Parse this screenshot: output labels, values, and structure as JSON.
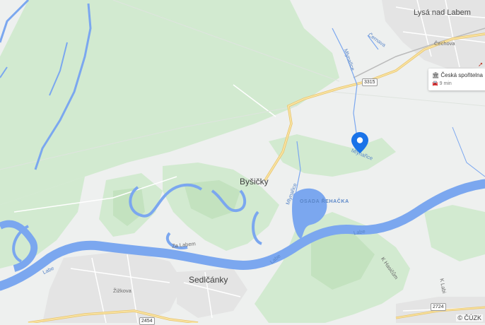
{
  "map": {
    "places": {
      "lysa": "Lysá nad Labem",
      "bysicky": "Byšičky",
      "sedlcanky": "Sedlčánky"
    },
    "streets": {
      "cechova": "Čechova",
      "za_labem": "Za Labem",
      "zizkova": "Žižkova",
      "k_hasicum": "K Hasičům",
      "k_labi": "K Labi"
    },
    "water": {
      "cernava": "Černava",
      "mlynarice_1": "Mlynařice",
      "mlynarice_2": "Mlynařice",
      "mlynarice_3": "Mlynařice",
      "labe_1": "Labe",
      "labe_2": "Labe",
      "labe_3": "Labe",
      "pond": "OSADA ŘEHAČKA"
    },
    "roads": {
      "r3315": "3315",
      "r2454": "2454",
      "r2724": "2724"
    },
    "info_card": {
      "title": "Česká spořitelna",
      "duration": "9 min",
      "title_icon": "bank-icon",
      "duration_icon": "car-icon"
    },
    "copyright": "© ČÚZK",
    "colors": {
      "water": "#7ba7ef",
      "forest": "#cde8c8",
      "road_major": "#f6d98a",
      "pin": "#1a73e8"
    }
  }
}
